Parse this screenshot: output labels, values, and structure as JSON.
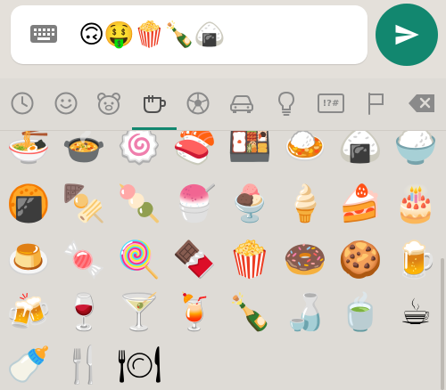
{
  "compose": {
    "keyboard_icon": "keyboard-icon",
    "text": "🙃🤑🍿🍾🍙",
    "send_icon": "send-icon",
    "accent": "#12876f"
  },
  "tabs": {
    "items": [
      {
        "name": "recent",
        "icon": "clock-icon"
      },
      {
        "name": "smileys",
        "icon": "smiley-icon"
      },
      {
        "name": "animals",
        "icon": "bear-icon"
      },
      {
        "name": "food",
        "icon": "cup-icon",
        "selected": true
      },
      {
        "name": "activity",
        "icon": "soccer-ball-icon"
      },
      {
        "name": "travel",
        "icon": "car-icon"
      },
      {
        "name": "objects",
        "icon": "lightbulb-icon"
      },
      {
        "name": "symbols",
        "icon": "symbols-icon",
        "label": "!?#"
      },
      {
        "name": "flags",
        "icon": "flag-icon"
      }
    ],
    "backspace_icon": "backspace-icon"
  },
  "grid": {
    "rows": [
      [
        "🍜",
        "🍲",
        "🍥",
        "🍣",
        "🍱",
        "🍛",
        "🍙",
        "🍚"
      ],
      [
        "🍘",
        "🍢",
        "🍡",
        "🍧",
        "🍨",
        "🍦",
        "🍰",
        "🎂"
      ],
      [
        "🍮",
        "🍬",
        "🍭",
        "🍫",
        "🍿",
        "🍩",
        "🍪",
        "🍺"
      ],
      [
        "🍻",
        "🍷",
        "🍸",
        "🍹",
        "🍾",
        "🍶",
        "🍵",
        "☕"
      ],
      [
        "🍼",
        "🍴",
        "🍽"
      ]
    ]
  }
}
